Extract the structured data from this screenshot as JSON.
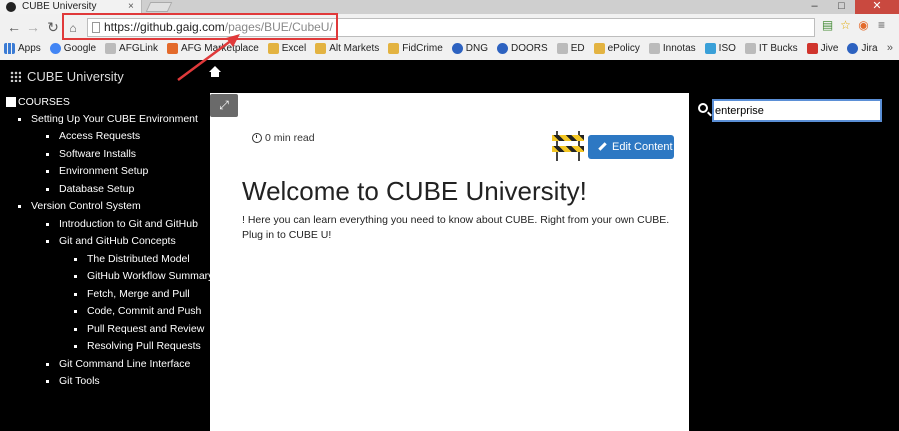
{
  "browser": {
    "tab_title": "CUBE University",
    "tab_close": "×",
    "window_buttons": [
      "–",
      "□",
      "✕"
    ],
    "url_main": "https://github.gaig.com",
    "url_path": "/pages/BUE/CubeU/"
  },
  "bookmarks": [
    {
      "label": "Apps",
      "icon": "apps-grid-icon"
    },
    {
      "label": "Google",
      "icon": "google-icon"
    },
    {
      "label": "AFGLink",
      "icon": "folder-icon"
    },
    {
      "label": "AFG Marketplace",
      "icon": "afg-icon"
    },
    {
      "label": "Excel",
      "icon": "folder-icon"
    },
    {
      "label": "Alt Markets",
      "icon": "folder-icon"
    },
    {
      "label": "FidCrime",
      "icon": "folder-icon"
    },
    {
      "label": "DNG",
      "icon": "dng-icon"
    },
    {
      "label": "DOORS",
      "icon": "doors-icon"
    },
    {
      "label": "ED",
      "icon": "ed-icon"
    },
    {
      "label": "ePolicy",
      "icon": "folder-icon"
    },
    {
      "label": "Innotas",
      "icon": "page-icon"
    },
    {
      "label": "ISO",
      "icon": "iso-icon"
    },
    {
      "label": "IT Bucks",
      "icon": "page-icon"
    },
    {
      "label": "Jive",
      "icon": "jive-icon"
    },
    {
      "label": "Jira",
      "icon": "jira-icon"
    }
  ],
  "app": {
    "brand": "CUBE University"
  },
  "sidebar": {
    "header": "COURSES",
    "items": [
      "Setting Up Your CUBE Environment",
      "Access Requests",
      "Software Installs",
      "Environment Setup",
      "Database Setup",
      "Version Control System",
      "Introduction to Git and GitHub",
      "Git and GitHub Concepts",
      "The Distributed Model",
      "GitHub Workflow Summary",
      "Fetch, Merge and Pull",
      "Code, Commit and Push",
      "Pull Request and Review",
      "Resolving Pull Requests",
      "Git Command Line Interface",
      "Git Tools"
    ]
  },
  "content": {
    "read_time": "0 min read",
    "edit_button": "Edit Content",
    "title": "Welcome to CUBE University!",
    "body": "! Here you can learn everything you need to know about CUBE. Right from your own CUBE. Plug in to CUBE U!"
  },
  "search": {
    "value": "enterprise"
  },
  "colors": {
    "accent": "#2d78c3",
    "annotation": "#e0393a"
  }
}
